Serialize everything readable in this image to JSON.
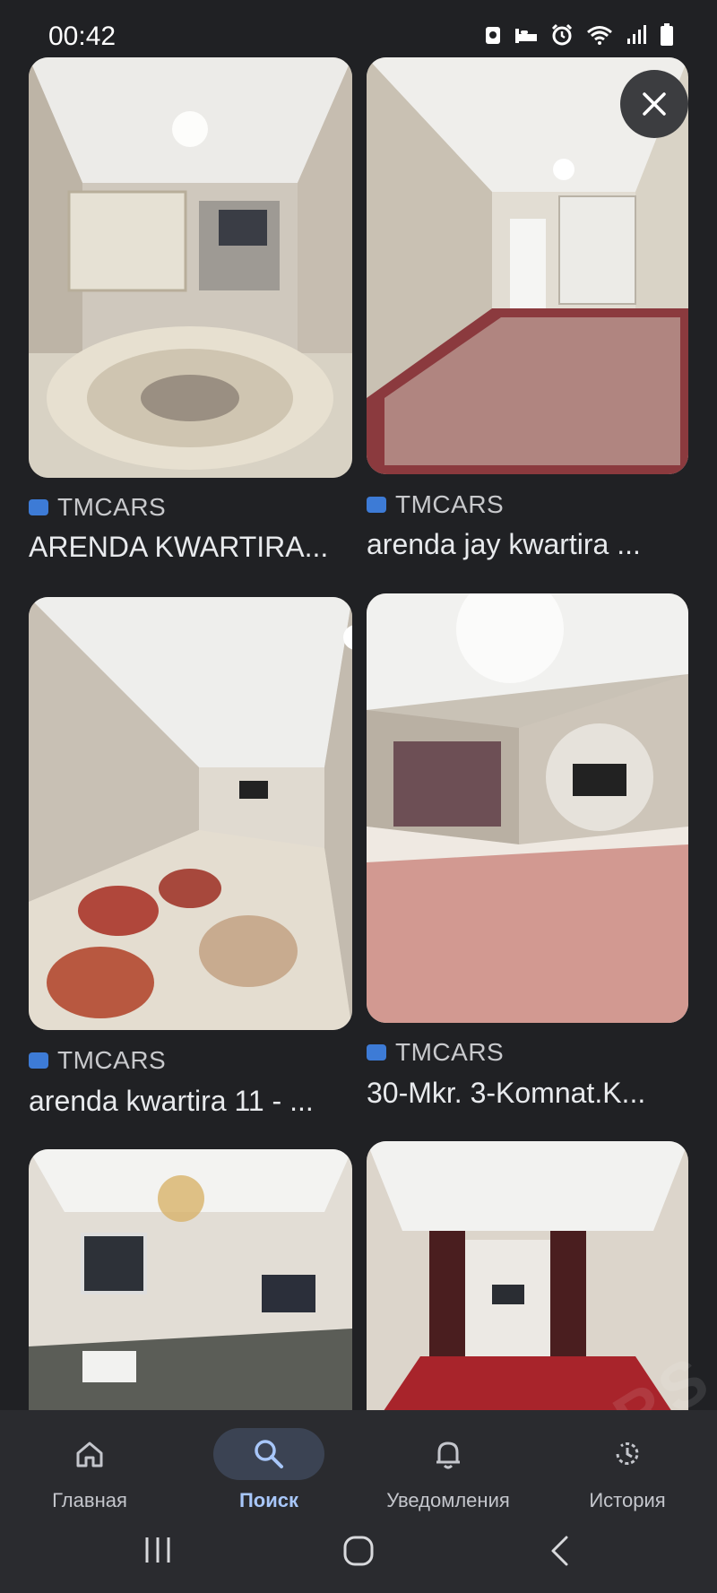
{
  "status_bar": {
    "time": "00:42",
    "icons": [
      "notification-icon",
      "sleep-icon",
      "alarm-icon",
      "wifi-icon",
      "signal-icon",
      "battery-icon"
    ]
  },
  "close_button": {
    "icon": "close-icon"
  },
  "results": [
    {
      "source": "TMCARS",
      "title": "ARENDA KWARTIRA..."
    },
    {
      "source": "TMCARS",
      "title": "arenda jay kwartira ..."
    },
    {
      "source": "TMCARS",
      "title": "arenda kwartira 11 - ..."
    },
    {
      "source": "TMCARS",
      "title": "30-Mkr. 3-Komnat.K..."
    },
    {
      "source": "",
      "title": ""
    },
    {
      "source": "",
      "title": ""
    }
  ],
  "bottom_nav": {
    "items": [
      {
        "label": "Главная",
        "icon": "home-icon"
      },
      {
        "label": "Поиск",
        "icon": "search-icon",
        "active": true
      },
      {
        "label": "Уведомления",
        "icon": "bell-icon"
      },
      {
        "label": "История",
        "icon": "history-icon"
      }
    ]
  },
  "system_nav": {
    "icons": [
      "recents-icon",
      "home-circle-icon",
      "back-icon"
    ]
  },
  "watermark": "TMCARS",
  "colors": {
    "background": "#202124",
    "accent": "#a8c7fa",
    "active_pill": "#3b4353"
  }
}
